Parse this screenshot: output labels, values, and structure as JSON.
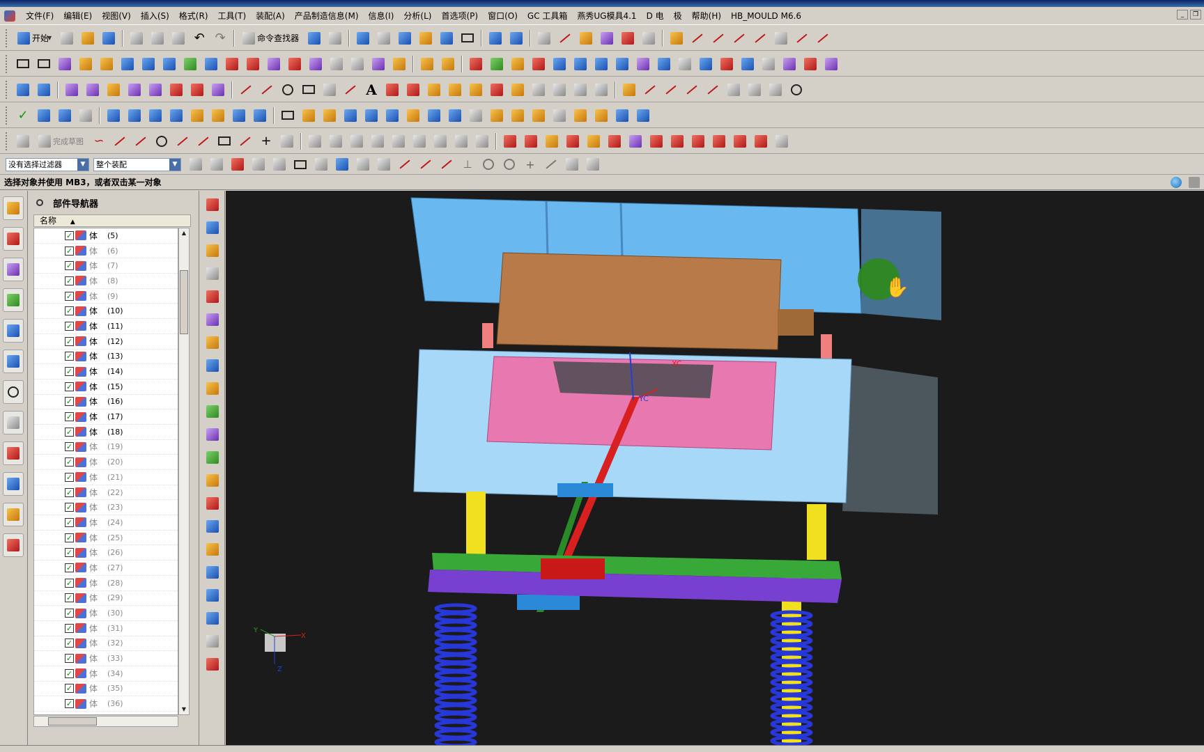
{
  "menu": {
    "items": [
      "文件(F)",
      "编辑(E)",
      "视图(V)",
      "插入(S)",
      "格式(R)",
      "工具(T)",
      "装配(A)",
      "产品制造信息(M)",
      "信息(I)",
      "分析(L)",
      "首选项(P)",
      "窗口(O)",
      "GC 工具箱",
      "燕秀UG模具4.1",
      "D 电",
      "极",
      "帮助(H)",
      "HB_MOULD M6.6"
    ]
  },
  "toolbar": {
    "start_label": "开始",
    "command_finder_label": "命令查找器",
    "finish_sketch_label": "完成草图"
  },
  "selection": {
    "filter_value": "没有选择过滤器",
    "scope_value": "整个装配"
  },
  "cue": {
    "text": "选择对象并使用 MB3，或者双击某一对象"
  },
  "navigator": {
    "title": "部件导航器",
    "column_name": "名称",
    "rows": [
      {
        "type": "体",
        "num": "(5)"
      },
      {
        "type": "体",
        "num": "(6)"
      },
      {
        "type": "体",
        "num": "(7)"
      },
      {
        "type": "体",
        "num": "(8)"
      },
      {
        "type": "体",
        "num": "(9)"
      },
      {
        "type": "体",
        "num": "(10)"
      },
      {
        "type": "体",
        "num": "(11)"
      },
      {
        "type": "体",
        "num": "(12)"
      },
      {
        "type": "体",
        "num": "(13)"
      },
      {
        "type": "体",
        "num": "(14)"
      },
      {
        "type": "体",
        "num": "(15)"
      },
      {
        "type": "体",
        "num": "(16)"
      },
      {
        "type": "体",
        "num": "(17)"
      },
      {
        "type": "体",
        "num": "(18)"
      },
      {
        "type": "体",
        "num": "(19)"
      },
      {
        "type": "体",
        "num": "(20)"
      },
      {
        "type": "体",
        "num": "(21)"
      },
      {
        "type": "体",
        "num": "(22)"
      },
      {
        "type": "体",
        "num": "(23)"
      },
      {
        "type": "体",
        "num": "(24)"
      },
      {
        "type": "体",
        "num": "(25)"
      },
      {
        "type": "体",
        "num": "(26)"
      },
      {
        "type": "体",
        "num": "(27)"
      },
      {
        "type": "体",
        "num": "(28)"
      },
      {
        "type": "体",
        "num": "(29)"
      },
      {
        "type": "体",
        "num": "(30)"
      },
      {
        "type": "体",
        "num": "(31)"
      },
      {
        "type": "体",
        "num": "(32)"
      },
      {
        "type": "体",
        "num": "(33)"
      },
      {
        "type": "体",
        "num": "(34)"
      },
      {
        "type": "体",
        "num": "(35)"
      },
      {
        "type": "体",
        "num": "(36)"
      }
    ]
  },
  "viewport": {
    "wcs_x_label": "XC",
    "wcs_y_label": "YC",
    "triad_x_label": "X",
    "triad_y_label": "Y",
    "triad_z_label": "Z",
    "colors": {
      "background": "#1b1b1b",
      "plate_blue": "#6ab8f0",
      "plate_light_blue": "#a8d8f8",
      "core_brown": "#b87a48",
      "cavity_pink": "#e878b0",
      "pin_yellow": "#f0e020",
      "ejector_green": "#38a838",
      "ejector_purple": "#7840d0",
      "spring_blue": "#2838d8",
      "lifter_red": "#d82020"
    }
  }
}
